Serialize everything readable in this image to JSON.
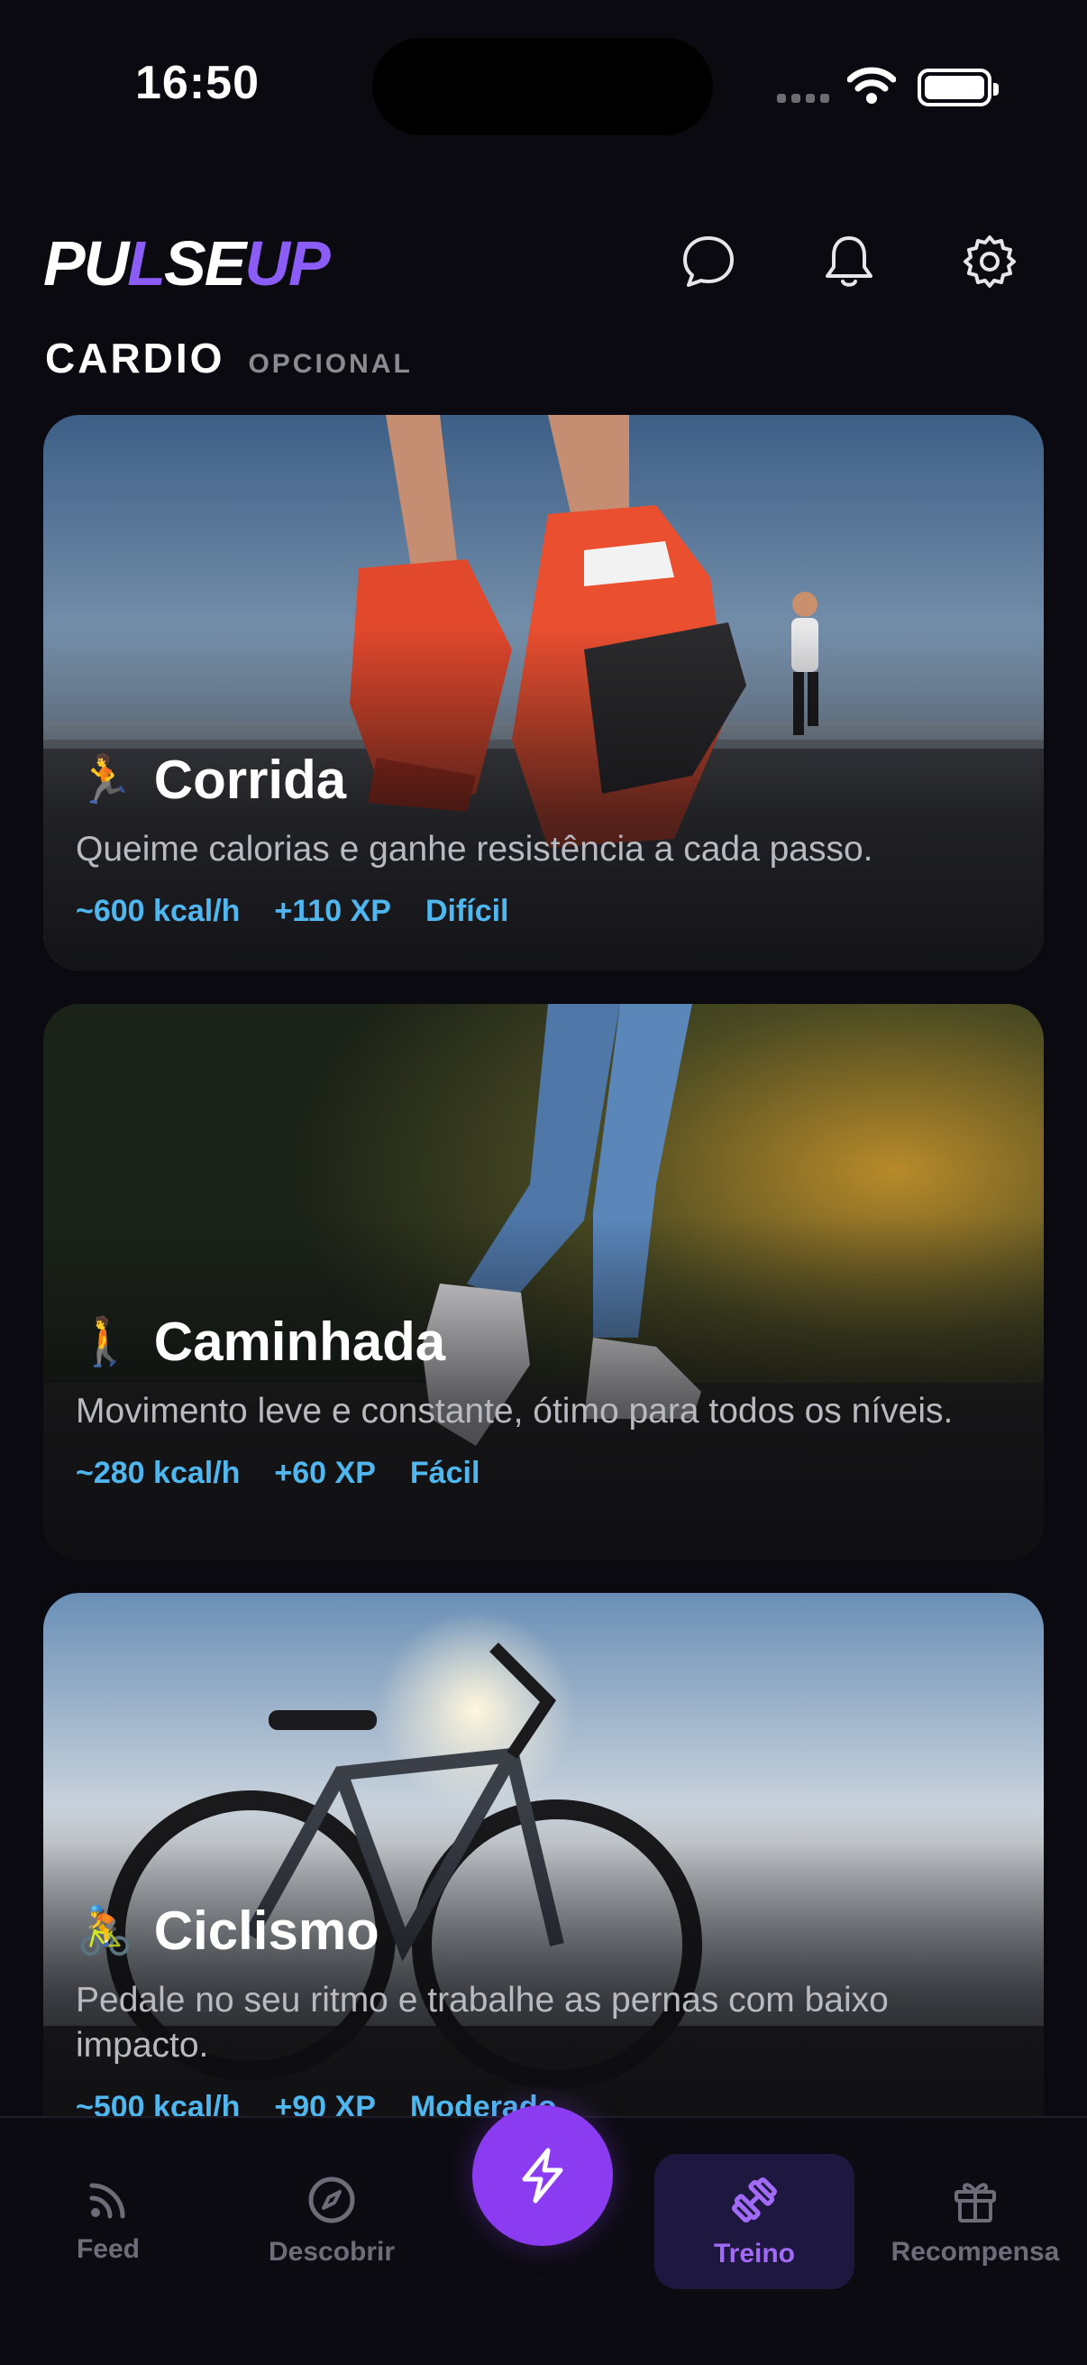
{
  "status_bar": {
    "time": "16:50"
  },
  "header": {
    "logo_pre": "PU",
    "logo_bolt": "L",
    "logo_mid": "SE",
    "logo_post": "UP"
  },
  "section": {
    "title": "CARDIO",
    "subtitle": "OPCIONAL"
  },
  "cards": [
    {
      "emoji": "🏃",
      "title": "Corrida",
      "description": "Queime calorias e ganhe resistência a cada passo.",
      "kcal": "~600 kcal/h",
      "xp": "+110 XP",
      "difficulty": "Difícil"
    },
    {
      "emoji": "🚶",
      "title": "Caminhada",
      "description": "Movimento leve e constante, ótimo para todos os níveis.",
      "kcal": "~280 kcal/h",
      "xp": "+60 XP",
      "difficulty": "Fácil"
    },
    {
      "emoji": "🚴",
      "title": "Ciclismo",
      "description": "Pedale no seu ritmo e trabalhe as pernas com baixo impacto.",
      "kcal": "~500 kcal/h",
      "xp": "+90 XP",
      "difficulty": "Moderado"
    }
  ],
  "nav": {
    "feed": "Feed",
    "discover": "Descobrir",
    "workout": "Treino",
    "rewards": "Recompensa",
    "active": "workout"
  },
  "icons": {
    "chat": "chat-bubble-icon",
    "bell": "bell-icon",
    "settings": "gear-icon",
    "feed": "rss-icon",
    "discover": "compass-icon",
    "fab": "lightning-icon",
    "workout": "dumbbell-icon",
    "rewards": "gift-icon"
  },
  "colors": {
    "background": "#0b0a10",
    "accent": "#8b3cf0",
    "stat": "#4fb6ee",
    "active_tab_bg": "#1e1740"
  }
}
